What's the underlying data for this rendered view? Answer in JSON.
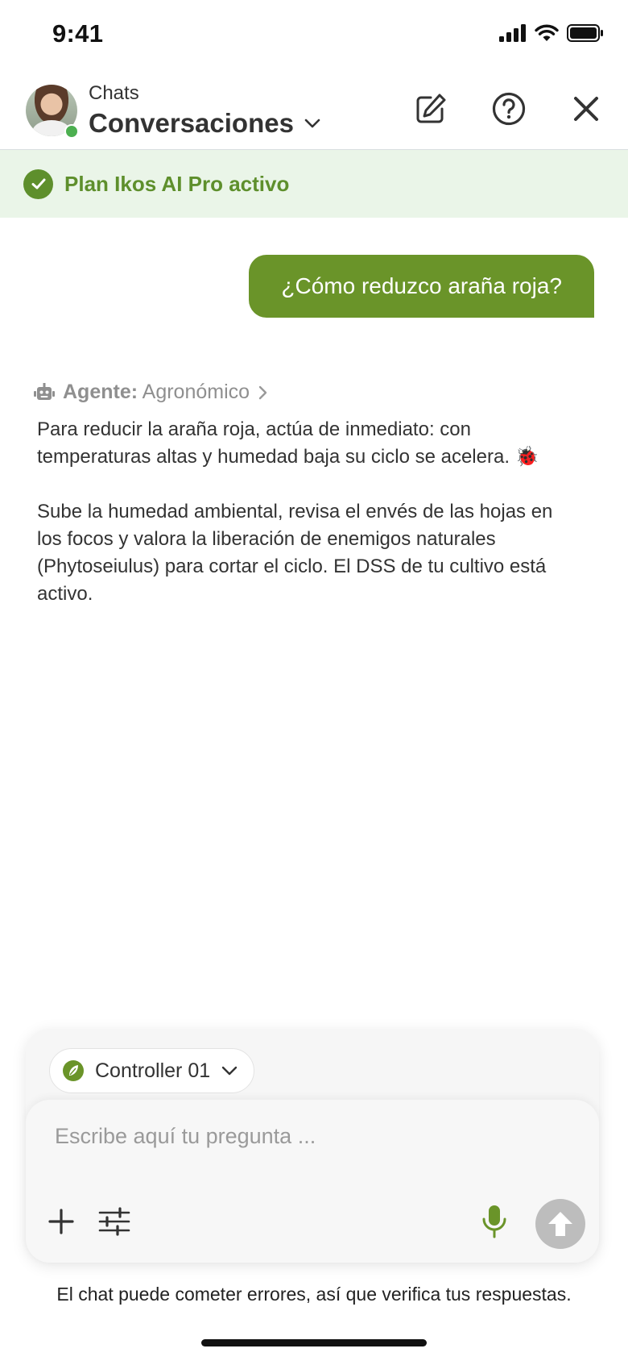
{
  "status_bar": {
    "time": "9:41"
  },
  "header": {
    "subtitle": "Chats",
    "title": "Conversaciones"
  },
  "plan_banner": {
    "text": "Plan Ikos AI Pro activo"
  },
  "messages": {
    "user": "¿Cómo reduzco araña roja?",
    "agent": {
      "label": "Agente:",
      "name": "Agronómico",
      "paragraph_1": "Para reducir la araña roja, actúa de inmediato: con temperaturas altas y humedad baja su ciclo se acelera. 🐞",
      "paragraph_2": "Sube la humedad ambiental, revisa el envés de las hojas en los focos y valora la liberación de enemigos naturales (Phytoseiulus) para cortar el ciclo. El DSS de tu cultivo está activo."
    }
  },
  "composer": {
    "controller_label": "Controller 01",
    "placeholder": "Escribe aquí tu pregunta ...",
    "value": ""
  },
  "disclaimer": "El chat puede cometer errores, así que verifica tus respuestas.",
  "colors": {
    "brand_green": "#6a9429",
    "banner_bg": "#eaf5e8",
    "banner_text": "#5e8f2c",
    "send_disabled": "#bdbdbd"
  },
  "icons": [
    "signal-icon",
    "wifi-icon",
    "battery-icon",
    "chevron-down-icon",
    "edit-icon",
    "help-icon",
    "close-icon",
    "check-circle-icon",
    "robot-icon",
    "chevron-right-icon",
    "leaf-icon",
    "plus-icon",
    "sliders-icon",
    "microphone-icon",
    "arrow-up-icon"
  ]
}
